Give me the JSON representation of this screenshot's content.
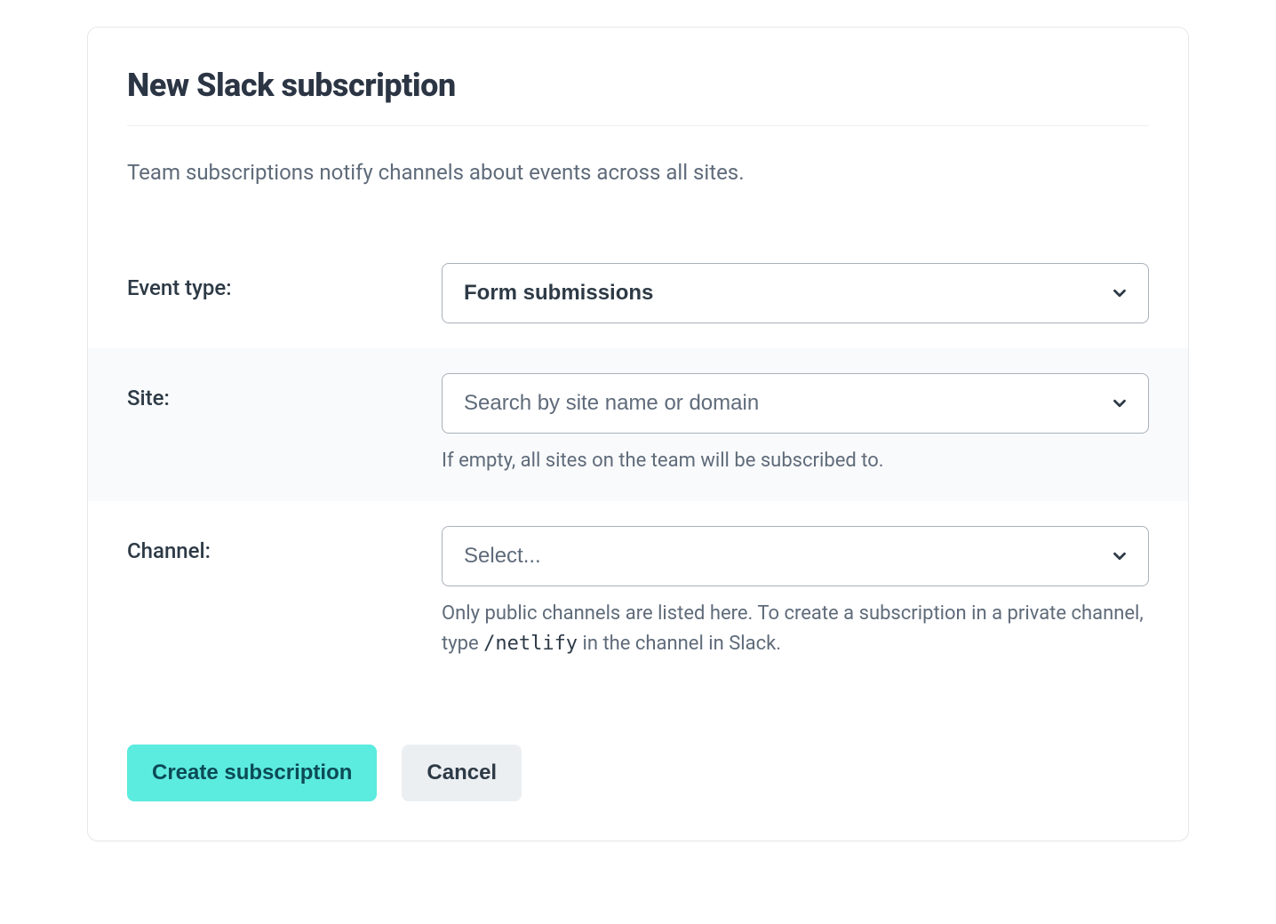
{
  "title": "New Slack subscription",
  "description": "Team subscriptions notify channels about events across all sites.",
  "form": {
    "event_type": {
      "label": "Event type:",
      "value": "Form submissions"
    },
    "site": {
      "label": "Site:",
      "placeholder": "Search by site name or domain",
      "helper": "If empty, all sites on the team will be subscribed to."
    },
    "channel": {
      "label": "Channel:",
      "placeholder": "Select...",
      "helper_prefix": "Only public channels are listed here. To create a subscription in a private channel, type ",
      "helper_command": "/netlify",
      "helper_suffix": " in the channel in Slack."
    }
  },
  "actions": {
    "create": "Create subscription",
    "cancel": "Cancel"
  }
}
